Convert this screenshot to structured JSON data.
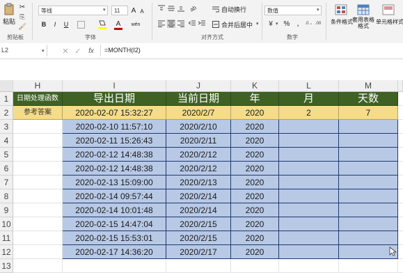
{
  "ribbon": {
    "clipboard": {
      "paste": "粘贴",
      "group": "剪贴板"
    },
    "font": {
      "name": "等线",
      "size": "11",
      "bold": "B",
      "italic": "I",
      "underline": "U",
      "grow": "A",
      "shrink": "A",
      "font_color": "A",
      "change_case": "wén",
      "group": "字体"
    },
    "alignment": {
      "wrap": "自动换行",
      "merge": "合并后居中",
      "group": "对齐方式"
    },
    "number": {
      "format": "数值",
      "percent": "%",
      "comma": ",",
      "group": "数字"
    },
    "styles": {
      "conditional": "条件格式",
      "table": "套用表格格式",
      "cell_styles": "单元格样式"
    }
  },
  "formula_bar": {
    "name_box": "L2",
    "formula": "=MONTH(I2)"
  },
  "columns": [
    "H",
    "I",
    "J",
    "K",
    "L",
    "M"
  ],
  "rows": [
    "1",
    "2",
    "3",
    "4",
    "5",
    "6",
    "7",
    "8",
    "9",
    "10",
    "11",
    "12",
    "13"
  ],
  "table": {
    "header": [
      "日期处理函数",
      "导出日期",
      "当前日期",
      "年",
      "月",
      "天数"
    ],
    "answer_label": "参考答案",
    "answer": [
      "2020-02-07 15:32:27",
      "2020/2/7",
      "2020",
      "2",
      "7"
    ],
    "data": [
      [
        "2020-02-10 11:57:10",
        "2020/2/10",
        "2020"
      ],
      [
        "2020-02-11 15:26:43",
        "2020/2/11",
        "2020"
      ],
      [
        "2020-02-12 14:48:38",
        "2020/2/12",
        "2020"
      ],
      [
        "2020-02-12 14:48:38",
        "2020/2/12",
        "2020"
      ],
      [
        "2020-02-13 15:09:00",
        "2020/2/13",
        "2020"
      ],
      [
        "2020-02-14 09:57:44",
        "2020/2/14",
        "2020"
      ],
      [
        "2020-02-14 10:01:48",
        "2020/2/14",
        "2020"
      ],
      [
        "2020-02-15 14:47:04",
        "2020/2/15",
        "2020"
      ],
      [
        "2020-02-15 15:53:01",
        "2020/2/15",
        "2020"
      ],
      [
        "2020-02-17 14:36:20",
        "2020/2/17",
        "2020"
      ]
    ]
  },
  "colors": {
    "header_green": "#3f6224",
    "answer_yellow": "#f6dc86",
    "data_blue": "#b8c9e6"
  }
}
